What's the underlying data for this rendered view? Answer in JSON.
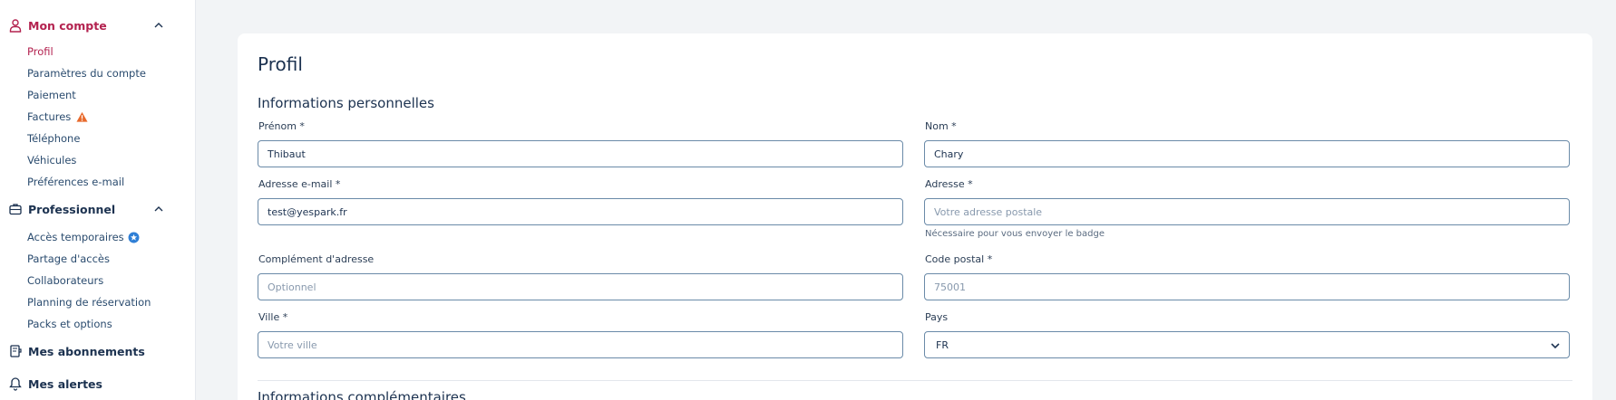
{
  "sidebar": {
    "account": {
      "title": "Mon compte",
      "icon": "user-icon",
      "color": "#b3224f",
      "items": [
        "Profil",
        "Paramètres du compte",
        "Paiement",
        "Factures",
        "Téléphone",
        "Véhicules",
        "Préférences e-mail"
      ]
    },
    "pro": {
      "title": "Professionnel",
      "icon": "briefcase-icon",
      "items": [
        "Accès temporaires",
        "Partage d'accès",
        "Collaborateurs",
        "Planning de réservation",
        "Packs et options"
      ]
    },
    "subscriptions": {
      "title": "Mes abonnements",
      "icon": "subscription-icon"
    },
    "alerts": {
      "title": "Mes alertes",
      "icon": "bell-icon"
    }
  },
  "page": {
    "title": "Profil",
    "section_personal": "Informations personnelles",
    "section_more": "Informations complémentaires"
  },
  "form": {
    "firstname": {
      "label": "Prénom *",
      "value": "Thibaut",
      "placeholder": ""
    },
    "lastname": {
      "label": "Nom *",
      "value": "Chary",
      "placeholder": ""
    },
    "email": {
      "label": "Adresse e-mail *",
      "value": "test@yespark.fr",
      "placeholder": ""
    },
    "address": {
      "label": "Adresse *",
      "value": "",
      "placeholder": "Votre adresse postale",
      "help": "Nécessaire pour vous envoyer le badge"
    },
    "address2": {
      "label": "Complément d'adresse",
      "value": "",
      "placeholder": "Optionnel"
    },
    "zipcode": {
      "label": "Code postal *",
      "value": "",
      "placeholder": "75001"
    },
    "city": {
      "label": "Ville *",
      "value": "",
      "placeholder": "Votre ville"
    },
    "country": {
      "label": "Pays",
      "value": "FR"
    }
  },
  "colors": {
    "accent": "#b3224f",
    "warning": "#e8692b",
    "info": "#2f7fd6",
    "text": "#1c3250"
  }
}
